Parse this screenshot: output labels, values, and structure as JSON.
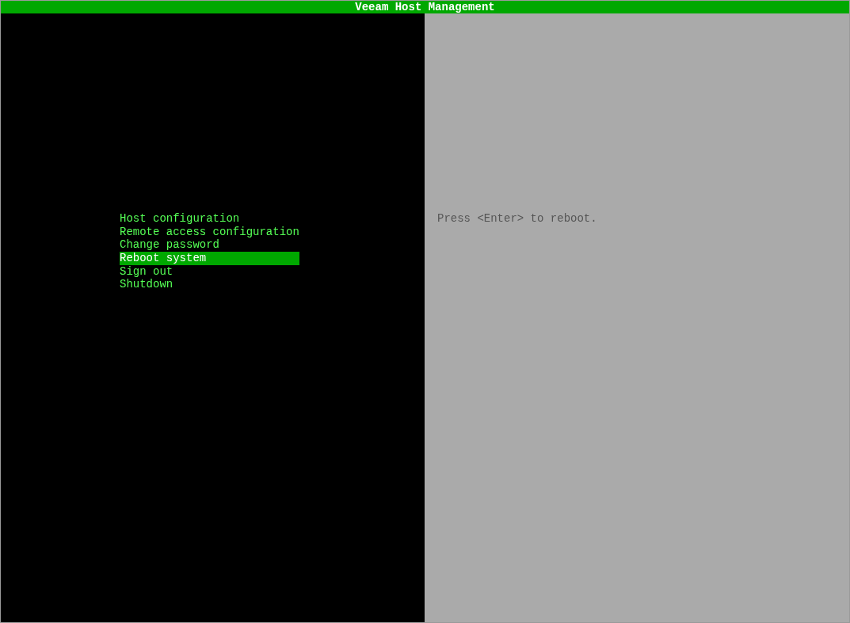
{
  "window": {
    "title": "Veeam Host Management"
  },
  "menu": {
    "items": [
      {
        "label": "Host configuration",
        "selected": false
      },
      {
        "label": "Remote access configuration",
        "selected": false
      },
      {
        "label": "Change password",
        "selected": false
      },
      {
        "label": "Reboot system",
        "selected": true
      },
      {
        "label": "Sign out",
        "selected": false
      },
      {
        "label": "Shutdown",
        "selected": false
      }
    ]
  },
  "description": {
    "text": "Press <Enter> to reboot."
  }
}
